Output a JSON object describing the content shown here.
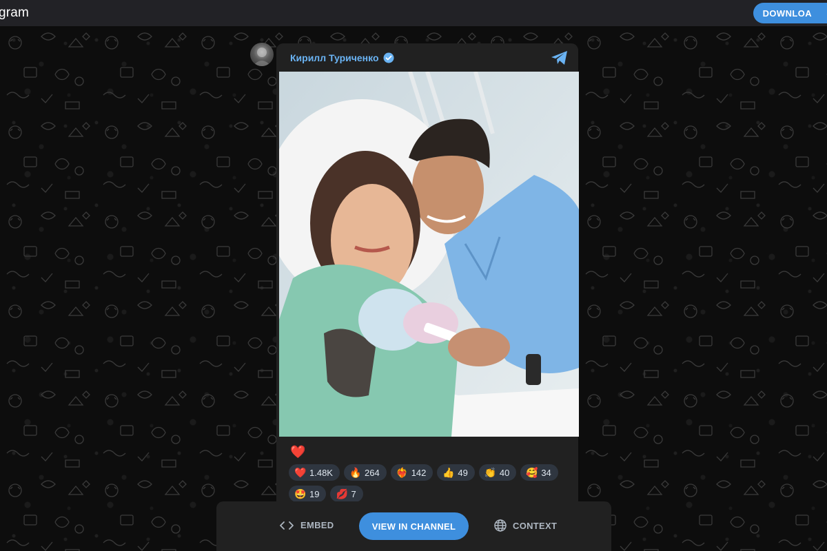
{
  "topbar": {
    "brand": "gram",
    "download_label": "DOWNLOA"
  },
  "post": {
    "author": "Кирилл Туриченко",
    "single_reaction": "❤️",
    "reactions": [
      {
        "emoji": "❤️",
        "count": "1.48K"
      },
      {
        "emoji": "🔥",
        "count": "264"
      },
      {
        "emoji": "❤️‍🔥",
        "count": "142"
      },
      {
        "emoji": "👍",
        "count": "49"
      },
      {
        "emoji": "👏",
        "count": "40"
      },
      {
        "emoji": "🥰",
        "count": "34"
      },
      {
        "emoji": "🤩",
        "count": "19"
      },
      {
        "emoji": "💋",
        "count": "7"
      }
    ]
  },
  "actions": {
    "embed_label": "EMBED",
    "view_label": "VIEW IN CHANNEL",
    "context_label": "CONTEXT"
  },
  "colors": {
    "accent": "#3e8fde",
    "author": "#6ab3f3",
    "card_bg": "#212121",
    "reaction_bg": "#2f3640"
  },
  "icons": [
    "telegram-icon",
    "verified-icon",
    "code-icon",
    "globe-icon"
  ]
}
